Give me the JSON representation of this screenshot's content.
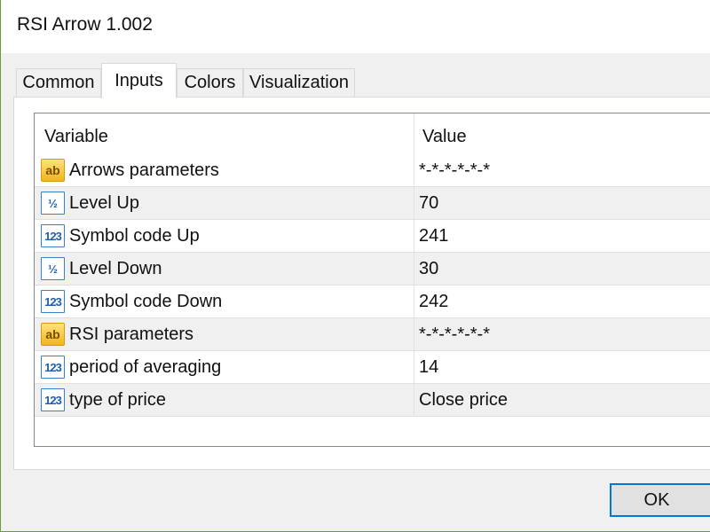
{
  "window": {
    "title": "RSI Arrow 1.002"
  },
  "tabs": [
    {
      "label": "Common"
    },
    {
      "label": "Inputs"
    },
    {
      "label": "Colors"
    },
    {
      "label": "Visualization"
    }
  ],
  "table": {
    "columns": [
      "Variable",
      "Value"
    ],
    "rows": [
      {
        "icon": "ab-string-icon",
        "icon_text": "ab",
        "variable": "Arrows parameters",
        "value": "*-*-*-*-*-*"
      },
      {
        "icon": "double-fraction-icon",
        "icon_text": "½",
        "variable": "Level Up",
        "value": "70"
      },
      {
        "icon": "integer-123-icon",
        "icon_text": "123",
        "variable": "Symbol code Up",
        "value": "241"
      },
      {
        "icon": "double-fraction-icon",
        "icon_text": "½",
        "variable": "Level Down",
        "value": "30"
      },
      {
        "icon": "integer-123-icon",
        "icon_text": "123",
        "variable": "Symbol code Down",
        "value": "242"
      },
      {
        "icon": "ab-string-icon",
        "icon_text": "ab",
        "variable": "RSI parameters",
        "value": "*-*-*-*-*-*"
      },
      {
        "icon": "integer-123-icon",
        "icon_text": "123",
        "variable": "period of averaging",
        "value": "14"
      },
      {
        "icon": "integer-123-icon",
        "icon_text": "123",
        "variable": "type of price",
        "value": "Close price"
      }
    ]
  },
  "buttons": {
    "ok_label": "OK"
  },
  "colors": {
    "accent": "#0078d7",
    "window_border": "#6a9a3c",
    "string_icon": "#f2b51e",
    "numeric_icon": "#3c7fc6"
  }
}
